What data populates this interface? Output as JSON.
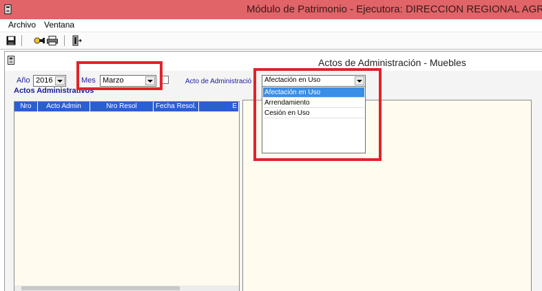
{
  "window": {
    "title": "Módulo de Patrimonio - Ejecutora: DIRECCION REGIONAL AGRARIA A"
  },
  "menu": {
    "items": [
      "Archivo",
      "Ventana"
    ]
  },
  "toolbar": {
    "buttons": [
      "save-icon",
      "connect-icon",
      "print-icon",
      "exit-icon"
    ]
  },
  "form": {
    "title": "Actos de Administración - Muebles",
    "anio_label": "Año",
    "anio_value": "2016",
    "mes_label": "Mes",
    "mes_value": "Marzo",
    "acto_label": "Acto de Administració",
    "acto_value": "Afectación en Uso",
    "section_title": "Actos Administrativos",
    "columns": [
      "Nro",
      "Acto Admin",
      "Nro Resol",
      "Fecha Resol.",
      "E"
    ],
    "dropdown_options": [
      "Afectación en Uso",
      "Arrendamiento",
      "Cesión en Uso"
    ],
    "dropdown_selected_index": 0
  },
  "colors": {
    "titlebar": "#e06468",
    "grid_header": "#2a5fd0",
    "highlight_box": "#e3212a",
    "selection": "#3a8ee6"
  }
}
